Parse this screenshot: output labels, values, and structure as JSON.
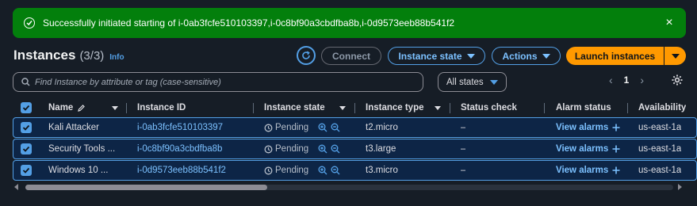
{
  "flash": {
    "icon": "check-circle-icon",
    "message": "Successfully initiated starting of i-0ab3fcfe510103397,i-0c8bf90a3cbdfba8b,i-0d9573eeb88b541f2",
    "close": "×",
    "color": "#037f0c"
  },
  "header": {
    "title": "Instances",
    "count": "(3/3)",
    "info": "Info"
  },
  "toolbar": {
    "connect": "Connect",
    "instance_state": "Instance state",
    "actions": "Actions",
    "launch": "Launch instances",
    "accent": "#ff9900"
  },
  "search": {
    "placeholder": "Find Instance by attribute or tag (case-sensitive)"
  },
  "filter": {
    "selected": "All states"
  },
  "pagination": {
    "prev": "‹",
    "page": "1",
    "next": "›"
  },
  "table": {
    "columns": {
      "name": "Name",
      "instance_id": "Instance ID",
      "instance_state": "Instance state",
      "instance_type": "Instance type",
      "status_check": "Status check",
      "alarm_status": "Alarm status",
      "availability": "Availability"
    },
    "rows": [
      {
        "name": "Kali Attacker",
        "id": "i-0ab3fcfe510103397",
        "state": "Pending",
        "type": "t2.micro",
        "status": "–",
        "alarm": "View alarms",
        "az": "us-east-1a"
      },
      {
        "name": "Security Tools ...",
        "id": "i-0c8bf90a3cbdfba8b",
        "state": "Pending",
        "type": "t3.large",
        "status": "–",
        "alarm": "View alarms",
        "az": "us-east-1a"
      },
      {
        "name": "Windows 10 ...",
        "id": "i-0d9573eeb88b541f2",
        "state": "Pending",
        "type": "t3.micro",
        "status": "–",
        "alarm": "View alarms",
        "az": "us-east-1a"
      }
    ]
  }
}
